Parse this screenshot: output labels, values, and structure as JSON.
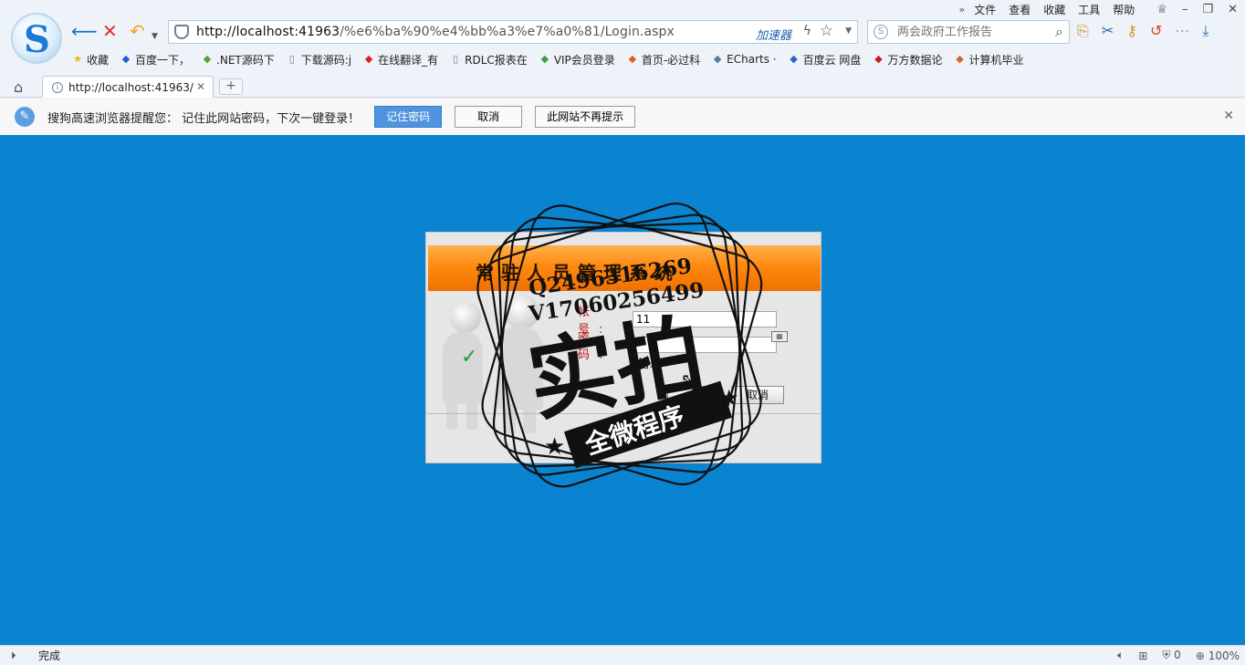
{
  "menubar": {
    "items": [
      "文件",
      "查看",
      "收藏",
      "工具",
      "帮助"
    ]
  },
  "nav": {
    "url_host": "http://localhost:41963",
    "url_path": "/%e6%ba%90%e4%bb%a3%e7%a0%81/Login.aspx",
    "accelerator_label": "加速器",
    "search_placeholder": "两会政府工作报告"
  },
  "favorites": [
    {
      "label": "收藏",
      "icon": "star-icon",
      "color": "#f0b020"
    },
    {
      "label": "百度一下，",
      "icon": "baidu-paw-icon",
      "color": "#2a5bd7"
    },
    {
      "label": ".NET源码下",
      "icon": "net-icon",
      "color": "#5aa030"
    },
    {
      "label": "下载源码:j",
      "icon": "page-icon",
      "color": "#6a7a90"
    },
    {
      "label": "在线翻译_有",
      "icon": "youdao-icon",
      "color": "#e02020"
    },
    {
      "label": "RDLC报表在",
      "icon": "page-icon",
      "color": "#6a7a90"
    },
    {
      "label": "VIP会员登录",
      "icon": "vip-icon",
      "color": "#40a040"
    },
    {
      "label": "首页-必过科",
      "icon": "site-icon",
      "color": "#e06020"
    },
    {
      "label": "ECharts ·",
      "icon": "echarts-icon",
      "color": "#5a7a9a"
    },
    {
      "label": "百度云 网盘",
      "icon": "cloud-icon",
      "color": "#3060c0"
    },
    {
      "label": "万方数据论",
      "icon": "wanfang-icon",
      "color": "#c02020"
    },
    {
      "label": "计算机毕业",
      "icon": "site-icon",
      "color": "#e06020"
    }
  ],
  "tab": {
    "title": "http://localhost:41963/"
  },
  "notification": {
    "message": "搜狗高速浏览器提醒您： 记住此网站密码，下次一键登录！",
    "remember_label": "记住密码",
    "cancel_label": "取消",
    "never_label": "此网站不再提示"
  },
  "login": {
    "title": "常驻人员管理系统",
    "account_label": "帐号:",
    "account_value": "11",
    "password_label": "密码:",
    "role_value": "管理",
    "cancel_label": "取消"
  },
  "watermark": {
    "contact_q": "Q2496316269",
    "contact_v": "V17060256499",
    "big_text": "实拍",
    "ribbon_text": "全微程序"
  },
  "status": {
    "text": "完成",
    "security_count": "0",
    "zoom": "100%"
  },
  "colors": {
    "page_background": "#0a84d0",
    "banner_orange": "#ff8a10",
    "label_red": "#c01010",
    "primary_button": "#4f94de"
  }
}
